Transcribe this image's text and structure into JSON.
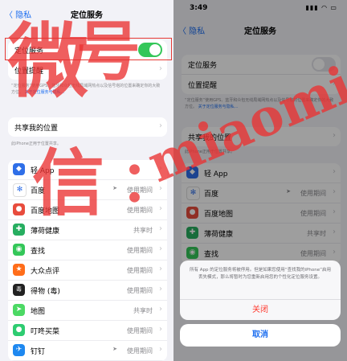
{
  "left": {
    "nav_back": "〈 隐私",
    "nav_title": "定位服务",
    "location_services_label": "定位服务",
    "location_toggle_state": "on",
    "location_alerts_label": "位置提醒",
    "desc_text": "“定位服务”使用GPS、蓝牙和众包无线局域网热点以及信号塔的位置来确定你的大致方位。",
    "desc_link": "关于定位服务与隐私…",
    "share_label": "共享我的位置",
    "share_desc": "此iPhone正用于位置共享。",
    "apps": [
      {
        "name": "轻 App",
        "status": "",
        "arrow": false,
        "color": "#2f6fe8",
        "glyph": "◆"
      },
      {
        "name": "百度",
        "status": "使用期间",
        "arrow": true,
        "color": "#ffffff",
        "glyph": "✻"
      },
      {
        "name": "百度地图",
        "status": "使用期间",
        "arrow": false,
        "color": "#e84c3d",
        "glyph": "●"
      },
      {
        "name": "薄荷健康",
        "status": "共享时",
        "arrow": false,
        "color": "#27ae60",
        "glyph": "✚"
      },
      {
        "name": "查找",
        "status": "使用期间",
        "arrow": false,
        "color": "#34c759",
        "glyph": "◉"
      },
      {
        "name": "大众点评",
        "status": "使用期间",
        "arrow": false,
        "color": "#ff6d1a",
        "glyph": "★"
      },
      {
        "name": "得物 (毒)",
        "status": "使用期间",
        "arrow": false,
        "color": "#222222",
        "glyph": "毒"
      },
      {
        "name": "地图",
        "status": "共享时",
        "arrow": false,
        "color": "#4cd964",
        "glyph": "➤"
      },
      {
        "name": "叮咚买菜",
        "status": "使用期间",
        "arrow": false,
        "color": "#2ecc71",
        "glyph": "●"
      },
      {
        "name": "钉钉",
        "status": "使用期间",
        "arrow": true,
        "color": "#1e88f0",
        "glyph": "✈"
      }
    ]
  },
  "right": {
    "time": "3:49",
    "indicators": "▮▮▮ ◠ ▭",
    "nav_back": "〈 隐私",
    "nav_title": "定位服务",
    "location_services_label": "定位服务",
    "location_toggle_state": "off",
    "location_alerts_label": "位置提醒",
    "desc_text": "“定位服务”使用GPS、蓝牙和众包无线局域网热点以及信号塔的位置来确定你的大致方位。",
    "desc_link": "关于定位服务与隐私…",
    "share_label": "共享我的位置",
    "share_desc": "此iPhone正用于位置共享。",
    "apps": [
      {
        "name": "轻 App",
        "status": "",
        "arrow": false,
        "color": "#2f6fe8",
        "glyph": "◆"
      },
      {
        "name": "百度",
        "status": "使用期间",
        "arrow": true,
        "color": "#ffffff",
        "glyph": "✻"
      },
      {
        "name": "百度地图",
        "status": "使用期间",
        "arrow": false,
        "color": "#e84c3d",
        "glyph": "●"
      },
      {
        "name": "薄荷健康",
        "status": "共享时",
        "arrow": false,
        "color": "#27ae60",
        "glyph": "✚"
      },
      {
        "name": "查找",
        "status": "使用期间",
        "arrow": false,
        "color": "#34c759",
        "glyph": "◉"
      }
    ],
    "sheet_message": "所有 App 的定位服务将被停用。但是如果您使用“查找我的iPhone”启用丢失模式，那么将暂时为您重新启用您的个性化定位服务设置。",
    "sheet_close": "关闭",
    "sheet_cancel": "取消"
  },
  "watermarks": [
    {
      "text": "微",
      "color": "#e53232"
    },
    {
      "text": "信",
      "color": "#e53232"
    },
    {
      "text": "号",
      "color": "#e53232"
    },
    {
      "text": "：",
      "color": "#e53232"
    },
    {
      "text": "miaomiaoxhj",
      "color": "#e53232"
    }
  ],
  "colors": {
    "accent": "#1e6ff0",
    "toggle_on": "#34c759",
    "destructive": "#ff3b30",
    "highlight_box": "#e53935"
  }
}
